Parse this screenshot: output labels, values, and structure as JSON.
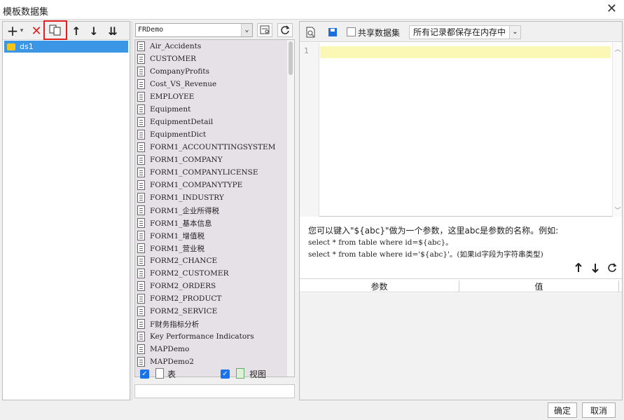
{
  "window": {
    "title": "模板数据集",
    "close_label": "✕"
  },
  "left_toolbar": {
    "add_label": "+",
    "dropdown_label": "▾",
    "delete_label": "✕",
    "move_up_label": "↑",
    "move_down_label": "↓",
    "move_bottom_label": "⇊"
  },
  "datasets": [
    {
      "label": "ds1",
      "selected": true
    }
  ],
  "db_select": {
    "value": "FRDemo",
    "arrow": "⌄"
  },
  "tables": [
    "Air_Accidents",
    "CUSTOMER",
    "CompanyProfits",
    "Cost_VS_Revenue",
    "EMPLOYEE",
    "Equipment",
    "EquipmentDetail",
    "EquipmentDict",
    "FORM1_ACCOUNTTINGSYSTEM",
    "FORM1_COMPANY",
    "FORM1_COMPANYLICENSE",
    "FORM1_COMPANYTYPE",
    "FORM1_INDUSTRY",
    "FORM1_企业所得税",
    "FORM1_基本信息",
    "FORM1_增值税",
    "FORM1_营业税",
    "FORM2_CHANCE",
    "FORM2_CUSTOMER",
    "FORM2_ORDERS",
    "FORM2_PRODUCT",
    "FORM2_SERVICE",
    "F财务指标分析",
    "Key Performance Indicators",
    "MAPDemo",
    "MAPDemo2"
  ],
  "filters": {
    "table_label": "表",
    "view_label": "视图",
    "table_checked": true,
    "view_checked": true
  },
  "right_toolbar": {
    "share_label": "共享数据集",
    "memory_option": "所有记录都保存在内存中",
    "arrow": "⌄"
  },
  "editor": {
    "line_number": "1"
  },
  "hint": {
    "line1": "您可以键入\"${abc}\"做为一个参数，这里abc是参数的名称。例如:",
    "line2": "select * from table where id=${abc}。",
    "line3": "select * from table where id='${abc}'。(如果id字段为字符串类型)"
  },
  "param_table": {
    "col_param": "参数",
    "col_value": "值"
  },
  "buttons": {
    "ok": "确定",
    "cancel": "取消"
  },
  "colors": {
    "selection": "#3c96e6",
    "highlight_box": "#e02020",
    "current_line": "#fbf8b6"
  }
}
